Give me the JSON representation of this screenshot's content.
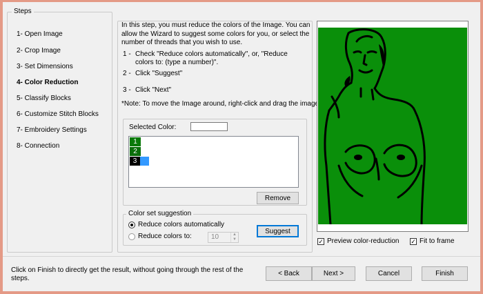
{
  "steps": {
    "legend": "Steps",
    "items": [
      {
        "label": "1- Open Image",
        "active": false
      },
      {
        "label": "2- Crop Image",
        "active": false
      },
      {
        "label": "3- Set Dimensions",
        "active": false
      },
      {
        "label": "4- Color Reduction",
        "active": true
      },
      {
        "label": "5- Classify Blocks",
        "active": false
      },
      {
        "label": "6- Customize Stitch Blocks",
        "active": false
      },
      {
        "label": "7- Embroidery Settings",
        "active": false
      },
      {
        "label": "8- Connection",
        "active": false
      }
    ]
  },
  "main": {
    "intro": "In this step, you must reduce the colors of the Image. You can allow the Wizard to suggest some colors for you, or select the number of threads that you wish to use.",
    "instructions": [
      {
        "num": "1 -",
        "text": "Check \"Reduce colors automatically\", or, \"Reduce colors to: (type a number)\"."
      },
      {
        "num": "2 -",
        "text": "Click \"Suggest\""
      },
      {
        "num": "3 -",
        "text": "Click \"Next\""
      }
    ],
    "note": "*Note: To move the Image around, right-click and drag the image"
  },
  "colors": {
    "selected_label": "Selected Color:",
    "items": [
      {
        "label": "1",
        "color": "#0a7a0a"
      },
      {
        "label": "2",
        "color": "#0a6e0a"
      },
      {
        "label": "3",
        "color": "#000000"
      }
    ],
    "remove_label": "Remove"
  },
  "suggestion": {
    "legend": "Color set suggestion",
    "auto_label": "Reduce colors automatically",
    "manual_label": "Reduce colors to:",
    "manual_value": "10",
    "suggest_label": "Suggest",
    "selected_mode": "auto"
  },
  "preview": {
    "background": "#0a8f0a",
    "preview_label": "Preview color-reduction",
    "preview_checked": true,
    "fit_label": "Fit to frame",
    "fit_checked": true
  },
  "footer": {
    "hint": "Click on Finish to directly get the result, without going through the rest of the steps.",
    "back_label": "< Back",
    "next_label": "Next >",
    "cancel_label": "Cancel",
    "finish_label": "Finish"
  }
}
